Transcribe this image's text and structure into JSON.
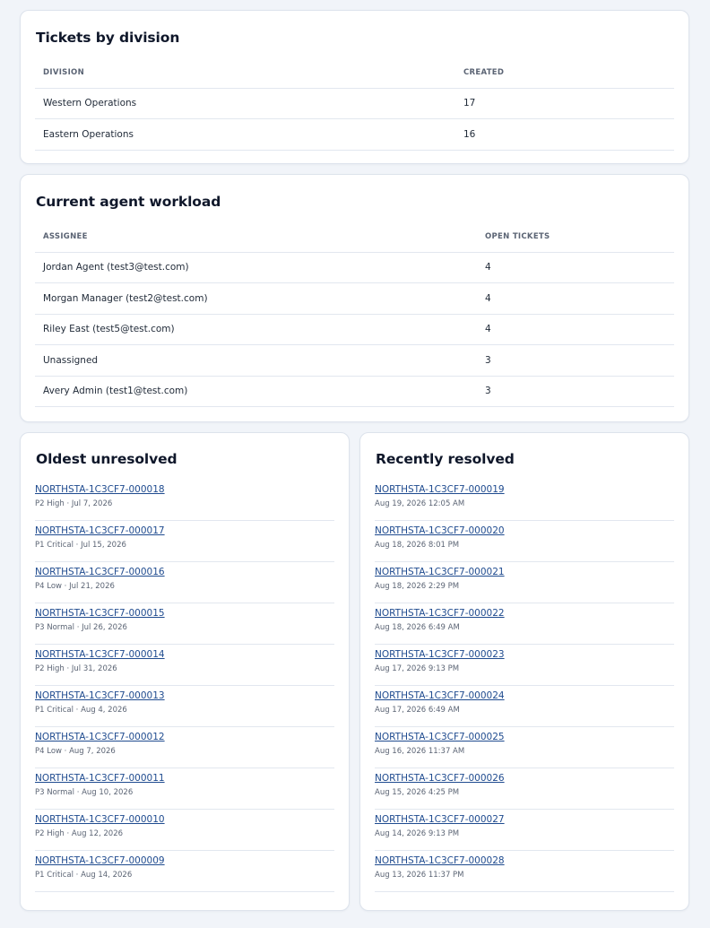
{
  "division": {
    "title": "Tickets by division",
    "columns": [
      "DIVISION",
      "CREATED"
    ],
    "rows": [
      {
        "name": "Western Operations",
        "created": "17"
      },
      {
        "name": "Eastern Operations",
        "created": "16"
      }
    ]
  },
  "workload": {
    "title": "Current agent workload",
    "columns": [
      "ASSIGNEE",
      "OPEN TICKETS"
    ],
    "rows": [
      {
        "assignee": "Jordan Agent (test3@test.com)",
        "open": "4"
      },
      {
        "assignee": "Morgan Manager (test2@test.com)",
        "open": "4"
      },
      {
        "assignee": "Riley East (test5@test.com)",
        "open": "4"
      },
      {
        "assignee": "Unassigned",
        "open": "3"
      },
      {
        "assignee": "Avery Admin (test1@test.com)",
        "open": "3"
      }
    ]
  },
  "oldest": {
    "title": "Oldest unresolved",
    "items": [
      {
        "id": "NORTHSTA-1C3CF7-000018",
        "meta": "P2 High · Jul 7, 2026"
      },
      {
        "id": "NORTHSTA-1C3CF7-000017",
        "meta": "P1 Critical · Jul 15, 2026"
      },
      {
        "id": "NORTHSTA-1C3CF7-000016",
        "meta": "P4 Low · Jul 21, 2026"
      },
      {
        "id": "NORTHSTA-1C3CF7-000015",
        "meta": "P3 Normal · Jul 26, 2026"
      },
      {
        "id": "NORTHSTA-1C3CF7-000014",
        "meta": "P2 High · Jul 31, 2026"
      },
      {
        "id": "NORTHSTA-1C3CF7-000013",
        "meta": "P1 Critical · Aug 4, 2026"
      },
      {
        "id": "NORTHSTA-1C3CF7-000012",
        "meta": "P4 Low · Aug 7, 2026"
      },
      {
        "id": "NORTHSTA-1C3CF7-000011",
        "meta": "P3 Normal · Aug 10, 2026"
      },
      {
        "id": "NORTHSTA-1C3CF7-000010",
        "meta": "P2 High · Aug 12, 2026"
      },
      {
        "id": "NORTHSTA-1C3CF7-000009",
        "meta": "P1 Critical · Aug 14, 2026"
      }
    ]
  },
  "recent": {
    "title": "Recently resolved",
    "items": [
      {
        "id": "NORTHSTA-1C3CF7-000019",
        "meta": "Aug 19, 2026 12:05 AM"
      },
      {
        "id": "NORTHSTA-1C3CF7-000020",
        "meta": "Aug 18, 2026 8:01 PM"
      },
      {
        "id": "NORTHSTA-1C3CF7-000021",
        "meta": "Aug 18, 2026 2:29 PM"
      },
      {
        "id": "NORTHSTA-1C3CF7-000022",
        "meta": "Aug 18, 2026 6:49 AM"
      },
      {
        "id": "NORTHSTA-1C3CF7-000023",
        "meta": "Aug 17, 2026 9:13 PM"
      },
      {
        "id": "NORTHSTA-1C3CF7-000024",
        "meta": "Aug 17, 2026 6:49 AM"
      },
      {
        "id": "NORTHSTA-1C3CF7-000025",
        "meta": "Aug 16, 2026 11:37 AM"
      },
      {
        "id": "NORTHSTA-1C3CF7-000026",
        "meta": "Aug 15, 2026 4:25 PM"
      },
      {
        "id": "NORTHSTA-1C3CF7-000027",
        "meta": "Aug 14, 2026 9:13 PM"
      },
      {
        "id": "NORTHSTA-1C3CF7-000028",
        "meta": "Aug 13, 2026 11:37 PM"
      }
    ]
  }
}
